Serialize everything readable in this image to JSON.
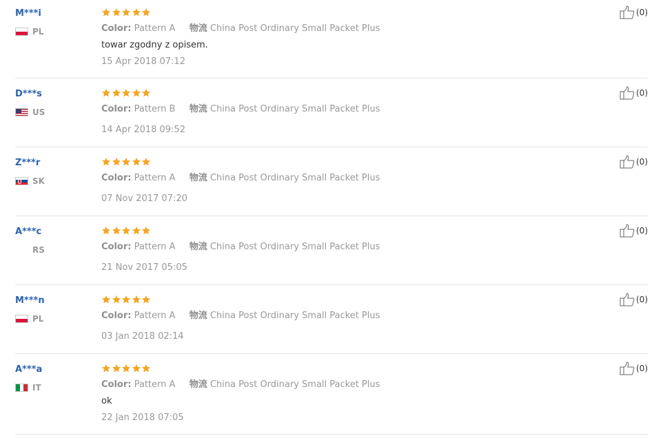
{
  "colors": {
    "buyer_name": "#2b63b0",
    "star": "#f5a623",
    "meta_text": "#999999",
    "separator": "#e5e5e5"
  },
  "icons": {
    "star": "star-icon",
    "helpful": "thumbs-up-icon"
  },
  "reviews": [
    {
      "buyer": "M***i",
      "country": "PL",
      "flag": "poland",
      "rating": 5,
      "color_label": "Color:",
      "color_value": "Pattern A",
      "shipping_label": "物流",
      "shipping_value": "China Post Ordinary Small Packet Plus",
      "comment": "towar zgodny z opisem.",
      "date": "15 Apr 2018 07:12",
      "helpful": "(0)"
    },
    {
      "buyer": "D***s",
      "country": "US",
      "flag": "usa",
      "rating": 5,
      "color_label": "Color:",
      "color_value": "Pattern B",
      "shipping_label": "物流",
      "shipping_value": "China Post Ordinary Small Packet Plus",
      "comment": "",
      "date": "14 Apr 2018 09:52",
      "helpful": "(0)"
    },
    {
      "buyer": "Z***r",
      "country": "SK",
      "flag": "slovakia",
      "rating": 5,
      "color_label": "Color:",
      "color_value": "Pattern A",
      "shipping_label": "物流",
      "shipping_value": "China Post Ordinary Small Packet Plus",
      "comment": "",
      "date": "07 Nov 2017 07:20",
      "helpful": "(0)"
    },
    {
      "buyer": "A***c",
      "country": "RS",
      "flag": "none",
      "rating": 5,
      "color_label": "Color:",
      "color_value": "Pattern A",
      "shipping_label": "物流",
      "shipping_value": "China Post Ordinary Small Packet Plus",
      "comment": "",
      "date": "21 Nov 2017 05:05",
      "helpful": "(0)"
    },
    {
      "buyer": "M***n",
      "country": "PL",
      "flag": "poland",
      "rating": 5,
      "color_label": "Color:",
      "color_value": "Pattern A",
      "shipping_label": "物流",
      "shipping_value": "China Post Ordinary Small Packet Plus",
      "comment": "",
      "date": "03 Jan 2018 02:14",
      "helpful": "(0)"
    },
    {
      "buyer": "A***a",
      "country": "IT",
      "flag": "italy",
      "rating": 5,
      "color_label": "Color:",
      "color_value": "Pattern A",
      "shipping_label": "物流",
      "shipping_value": "China Post Ordinary Small Packet Plus",
      "comment": "ok",
      "date": "22 Jan 2018 07:05",
      "helpful": "(0)"
    }
  ]
}
